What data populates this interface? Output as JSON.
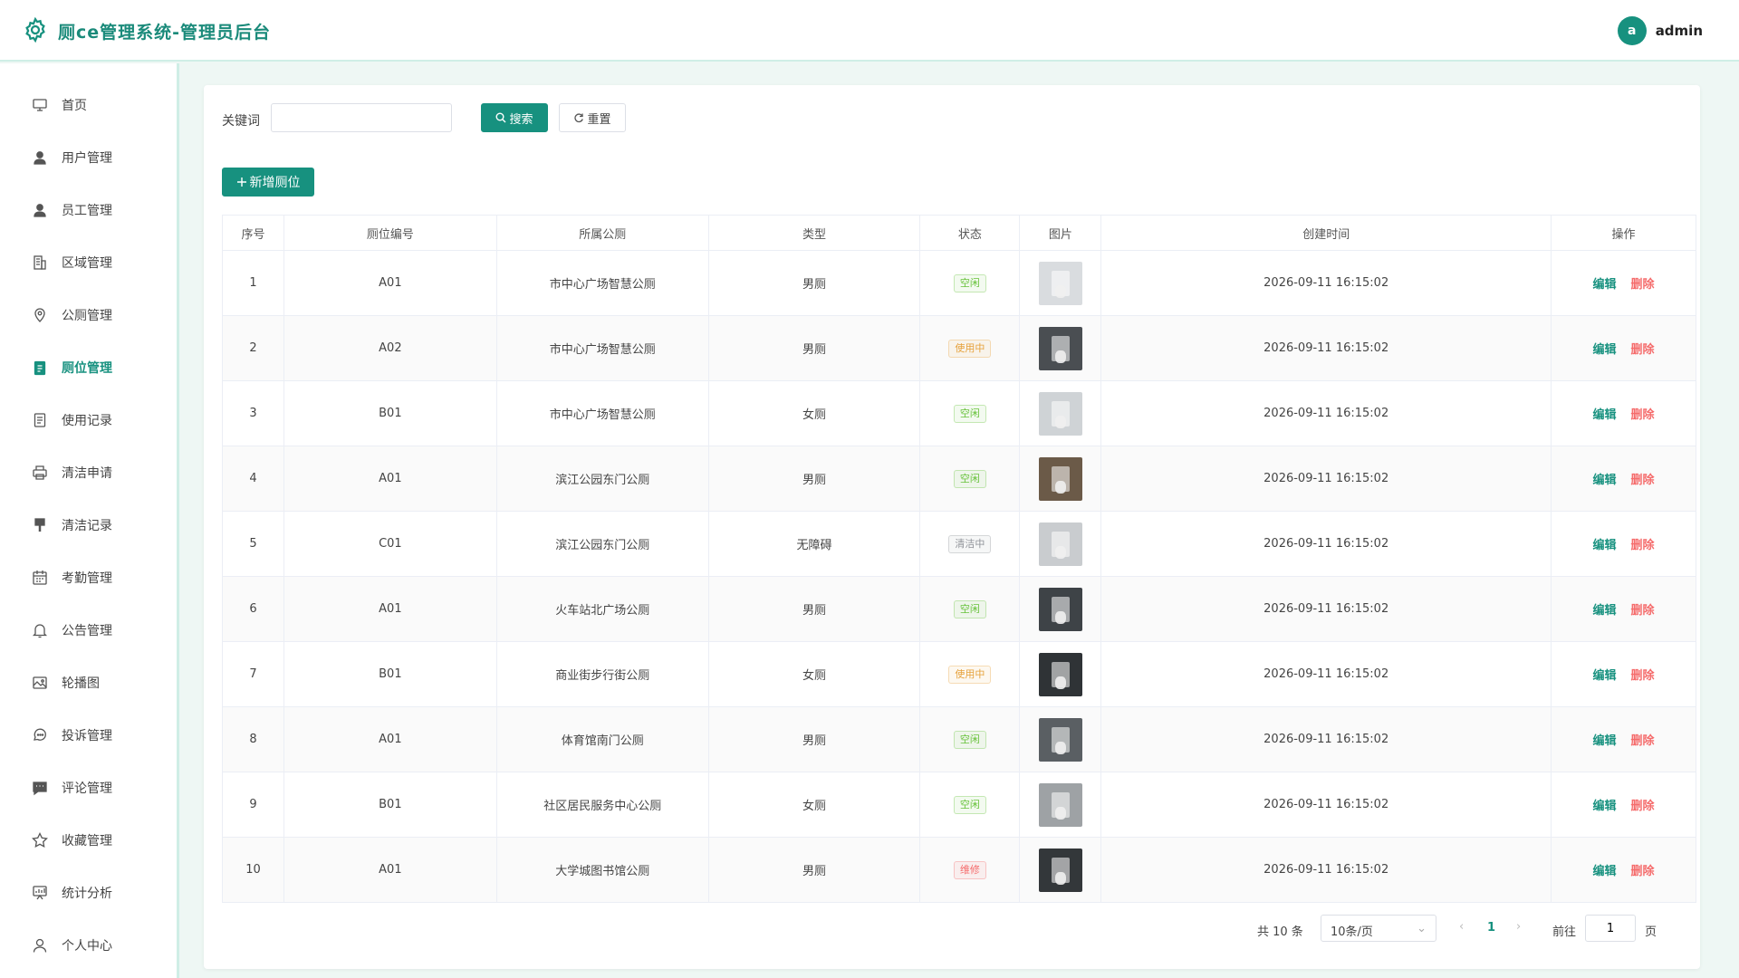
{
  "header": {
    "title": "厕ce管理系统-管理员后台",
    "avatar_letter": "a",
    "username": "admin"
  },
  "sidebar": {
    "items": [
      {
        "label": "首页",
        "icon": "monitor-icon"
      },
      {
        "label": "用户管理",
        "icon": "user-icon"
      },
      {
        "label": "员工管理",
        "icon": "user-icon"
      },
      {
        "label": "区域管理",
        "icon": "building-icon"
      },
      {
        "label": "公厕管理",
        "icon": "location-icon"
      },
      {
        "label": "厕位管理",
        "icon": "clipboard-icon",
        "active": true
      },
      {
        "label": "使用记录",
        "icon": "document-icon"
      },
      {
        "label": "清洁申请",
        "icon": "printer-icon"
      },
      {
        "label": "清洁记录",
        "icon": "brush-icon"
      },
      {
        "label": "考勤管理",
        "icon": "calendar-icon"
      },
      {
        "label": "公告管理",
        "icon": "bell-icon"
      },
      {
        "label": "轮播图",
        "icon": "picture-icon"
      },
      {
        "label": "投诉管理",
        "icon": "chat-icon"
      },
      {
        "label": "评论管理",
        "icon": "comment-icon"
      },
      {
        "label": "收藏管理",
        "icon": "star-icon"
      },
      {
        "label": "统计分析",
        "icon": "chart-icon"
      },
      {
        "label": "个人中心",
        "icon": "person-icon"
      }
    ]
  },
  "search": {
    "label": "关键词",
    "value": "",
    "placeholder": "",
    "search_button": "搜索",
    "reset_button": "重置"
  },
  "add_button": "新增厕位",
  "table": {
    "columns": [
      "序号",
      "厕位编号",
      "所属公厕",
      "类型",
      "状态",
      "图片",
      "创建时间",
      "操作"
    ],
    "rows": [
      {
        "no": "1",
        "code": "A01",
        "toilet": "市中心广场智慧公厕",
        "type": "男厕",
        "status": "空闲",
        "time": "2026-09-11 16:15:02"
      },
      {
        "no": "2",
        "code": "A02",
        "toilet": "市中心广场智慧公厕",
        "type": "男厕",
        "status": "使用中",
        "time": "2026-09-11 16:15:02"
      },
      {
        "no": "3",
        "code": "B01",
        "toilet": "市中心广场智慧公厕",
        "type": "女厕",
        "status": "空闲",
        "time": "2026-09-11 16:15:02"
      },
      {
        "no": "4",
        "code": "A01",
        "toilet": "滨江公园东门公厕",
        "type": "男厕",
        "status": "空闲",
        "time": "2026-09-11 16:15:02"
      },
      {
        "no": "5",
        "code": "C01",
        "toilet": "滨江公园东门公厕",
        "type": "无障碍",
        "status": "清洁中",
        "time": "2026-09-11 16:15:02"
      },
      {
        "no": "6",
        "code": "A01",
        "toilet": "火车站北广场公厕",
        "type": "男厕",
        "status": "空闲",
        "time": "2026-09-11 16:15:02"
      },
      {
        "no": "7",
        "code": "B01",
        "toilet": "商业街步行街公厕",
        "type": "女厕",
        "status": "使用中",
        "time": "2026-09-11 16:15:02"
      },
      {
        "no": "8",
        "code": "A01",
        "toilet": "体育馆南门公厕",
        "type": "男厕",
        "status": "空闲",
        "time": "2026-09-11 16:15:02"
      },
      {
        "no": "9",
        "code": "B01",
        "toilet": "社区居民服务中心公厕",
        "type": "女厕",
        "status": "空闲",
        "time": "2026-09-11 16:15:02"
      },
      {
        "no": "10",
        "code": "A01",
        "toilet": "大学城图书馆公厕",
        "type": "男厕",
        "status": "维修",
        "time": "2026-09-11 16:15:02"
      }
    ],
    "actions": {
      "edit": "编辑",
      "delete": "删除"
    }
  },
  "status_colors": {
    "空闲": "#67c23a",
    "使用中": "#e6a23c",
    "清洁中": "#909399",
    "维修": "#f56c6c"
  },
  "pagination": {
    "total": "共 10 条",
    "page_size": "10条/页",
    "current": "1",
    "goto_label": "前往",
    "goto_value": "1",
    "unit": "页"
  }
}
